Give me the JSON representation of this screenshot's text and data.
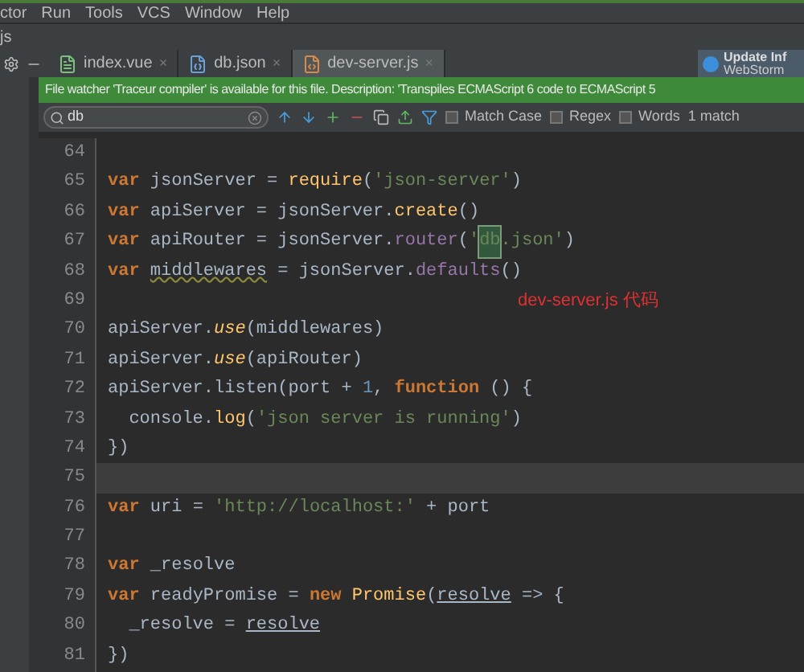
{
  "menu": [
    "ctor",
    "Run",
    "Tools",
    "VCS",
    "Window",
    "Help"
  ],
  "breadcrumb": "js",
  "tabs": [
    {
      "label": "index.vue",
      "kind": "vue",
      "selected": false,
      "close": "×"
    },
    {
      "label": "db.json",
      "kind": "json",
      "selected": false,
      "close": "×"
    },
    {
      "label": "dev-server.js",
      "kind": "js",
      "selected": true,
      "close": "×"
    }
  ],
  "notification": {
    "title": "Update Inf",
    "subtitle": "WebStorm"
  },
  "banner": "File watcher 'Traceur compiler' is available for this file. Description: 'Transpiles ECMAScript 6 code to ECMAScript 5",
  "search": {
    "value": "db",
    "options": [
      {
        "label": "Match Case",
        "checked": false
      },
      {
        "label": "Regex",
        "checked": false
      },
      {
        "label": "Words",
        "checked": false
      }
    ],
    "count": "1 match"
  },
  "lines": [
    {
      "number": "64",
      "current": false
    },
    {
      "number": "65",
      "current": false,
      "tokens": [
        {
          "kind": "kw",
          "text": "var"
        },
        {
          "kind": "plain",
          "text": " jsonServer = "
        },
        {
          "kind": "fn",
          "text": "require"
        },
        {
          "kind": "plain",
          "text": "("
        },
        {
          "kind": "str",
          "text": "'json-server'"
        },
        {
          "kind": "plain",
          "text": ")"
        }
      ]
    },
    {
      "number": "66",
      "current": false,
      "tokens": [
        {
          "kind": "kw",
          "text": "var"
        },
        {
          "kind": "plain",
          "text": " apiServer = jsonServer."
        },
        {
          "kind": "fn",
          "text": "create"
        },
        {
          "kind": "plain",
          "text": "()"
        }
      ]
    },
    {
      "number": "67",
      "current": false,
      "tokens": [
        {
          "kind": "kw",
          "text": "var"
        },
        {
          "kind": "plain",
          "text": " apiRouter = jsonServer."
        },
        {
          "kind": "prop",
          "text": "router"
        },
        {
          "kind": "plain",
          "text": "("
        },
        {
          "kind": "str",
          "text": "'"
        },
        {
          "kind": "match",
          "text": "db"
        },
        {
          "kind": "str",
          "text": ".json'"
        },
        {
          "kind": "plain",
          "text": ")"
        }
      ]
    },
    {
      "number": "68",
      "current": false,
      "tokens": [
        {
          "kind": "kw",
          "text": "var "
        },
        {
          "kind": "warn",
          "text": "middlewares"
        },
        {
          "kind": "plain",
          "text": " = jsonServer."
        },
        {
          "kind": "prop",
          "text": "defaults"
        },
        {
          "kind": "plain",
          "text": "()"
        }
      ]
    },
    {
      "number": "69",
      "current": false,
      "note": "dev-server.js 代码"
    },
    {
      "number": "70",
      "current": false,
      "tokens": [
        {
          "kind": "plain",
          "text": "apiServer."
        },
        {
          "kind": "ital",
          "text": "use"
        },
        {
          "kind": "plain",
          "text": "(middlewares)"
        }
      ]
    },
    {
      "number": "71",
      "current": false,
      "tokens": [
        {
          "kind": "plain",
          "text": "apiServer."
        },
        {
          "kind": "ital",
          "text": "use"
        },
        {
          "kind": "plain",
          "text": "(apiRouter)"
        }
      ]
    },
    {
      "number": "72",
      "current": false,
      "tokens": [
        {
          "kind": "plain",
          "text": "apiServer.listen(port + "
        },
        {
          "kind": "num",
          "text": "1"
        },
        {
          "kind": "plain",
          "text": ", "
        },
        {
          "kind": "kw",
          "text": "function"
        },
        {
          "kind": "plain",
          "text": " () {"
        }
      ]
    },
    {
      "number": "73",
      "current": false,
      "tokens": [
        {
          "kind": "plain",
          "text": "  console."
        },
        {
          "kind": "fn",
          "text": "log"
        },
        {
          "kind": "plain",
          "text": "("
        },
        {
          "kind": "str",
          "text": "'json server is running'"
        },
        {
          "kind": "plain",
          "text": ")"
        }
      ]
    },
    {
      "number": "74",
      "current": false,
      "tokens": [
        {
          "kind": "plain",
          "text": "})"
        }
      ]
    },
    {
      "number": "75",
      "current": true
    },
    {
      "number": "76",
      "current": false,
      "tokens": [
        {
          "kind": "kw",
          "text": "var"
        },
        {
          "kind": "plain",
          "text": " uri = "
        },
        {
          "kind": "str",
          "text": "'http://localhost:'"
        },
        {
          "kind": "plain",
          "text": " + port"
        }
      ]
    },
    {
      "number": "77",
      "current": false
    },
    {
      "number": "78",
      "current": false,
      "tokens": [
        {
          "kind": "kw",
          "text": "var"
        },
        {
          "kind": "plain",
          "text": " _resolve"
        }
      ]
    },
    {
      "number": "79",
      "current": false,
      "tokens": [
        {
          "kind": "kw",
          "text": "var"
        },
        {
          "kind": "plain",
          "text": " readyPromise = "
        },
        {
          "kind": "kw",
          "text": "new "
        },
        {
          "kind": "fn",
          "text": "Promise"
        },
        {
          "kind": "plain",
          "text": "("
        },
        {
          "kind": "under",
          "text": "resolve"
        },
        {
          "kind": "plain",
          "text": " => {"
        }
      ]
    },
    {
      "number": "80",
      "current": false,
      "tokens": [
        {
          "kind": "plain",
          "text": "  _resolve = "
        },
        {
          "kind": "under",
          "text": "resolve"
        }
      ]
    },
    {
      "number": "81",
      "current": false,
      "tokens": [
        {
          "kind": "plain",
          "text": "})"
        }
      ]
    }
  ]
}
